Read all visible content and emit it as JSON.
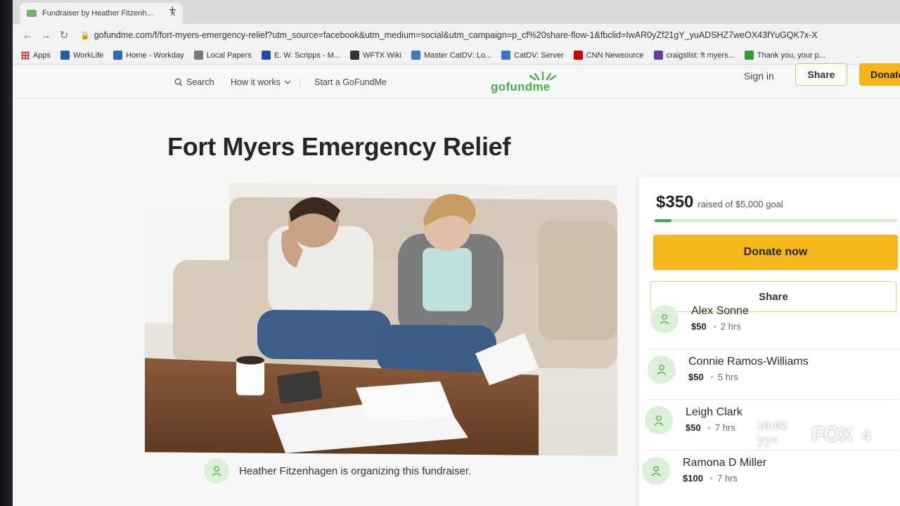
{
  "browser": {
    "tab_title": "Fundraiser by Heather Fitzenh...",
    "tab_close": "×",
    "new_tab": "+",
    "url": "gofundme.com/f/fort-myers-emergency-relief?utm_source=facebook&utm_medium=social&utm_campaign=p_cf%20share-flow-1&fbclid=IwAR0yZf21gY_yuADSHZ7weOX43fYuGQK7x-X",
    "bookmarks": [
      {
        "label": "Apps",
        "icon": "apps-grid-icon",
        "color": "#c0392b"
      },
      {
        "label": "WorkLife",
        "icon": "worklife-icon",
        "color": "#1f5fa8"
      },
      {
        "label": "Home - Workday",
        "icon": "workday-icon",
        "color": "#2f6db3"
      },
      {
        "label": "Local Papers",
        "icon": "folder-icon",
        "color": "#7a7a7a"
      },
      {
        "label": "E. W. Scripps - M...",
        "icon": "scripps-icon",
        "color": "#1d4fa0"
      },
      {
        "label": "WFTX Wiki",
        "icon": "wiki-icon",
        "color": "#333333"
      },
      {
        "label": "Master CatDV: Lo...",
        "icon": "catdv-icon",
        "color": "#3a78c2"
      },
      {
        "label": "CatDV: Server",
        "icon": "catdv-icon",
        "color": "#3a78c2"
      },
      {
        "label": "CNN Newsource",
        "icon": "cnn-icon",
        "color": "#cc0000"
      },
      {
        "label": "craigslist: ft myers...",
        "icon": "peace-icon",
        "color": "#6a3d9a"
      },
      {
        "label": "Thank you, your p...",
        "icon": "check-icon",
        "color": "#2e9d3a"
      }
    ]
  },
  "header": {
    "search": "Search",
    "how_it_works": "How it works",
    "start": "Start a GoFundMe",
    "logo": "gofundme",
    "sign_in": "Sign in",
    "share": "Share",
    "donate": "Donate"
  },
  "campaign": {
    "title": "Fort Myers Emergency Relief",
    "organizer_text": "Heather Fitzenhagen is organizing this fundraiser."
  },
  "card": {
    "raised": "$350",
    "goal_text": "raised of $5,000 goal",
    "progress_fraction": 0.07,
    "donate_now": "Donate now",
    "share": "Share",
    "donors": [
      {
        "name": "Alex Sonne",
        "amount": "$50",
        "time": "2 hrs"
      },
      {
        "name": "Connie Ramos-Williams",
        "amount": "$50",
        "time": "5 hrs"
      },
      {
        "name": "Leigh Clark",
        "amount": "$50",
        "time": "7 hrs"
      },
      {
        "name": "Ramona D Miller",
        "amount": "$100",
        "time": "7 hrs"
      }
    ],
    "separator": "•"
  },
  "overlay": {
    "time": "10:02",
    "temp": "77°",
    "station": "FOX",
    "channel": "4"
  },
  "colors": {
    "brand_green": "#4aaf4a",
    "donate_yellow": "#f5b71e",
    "share_border": "#e5cd78"
  }
}
